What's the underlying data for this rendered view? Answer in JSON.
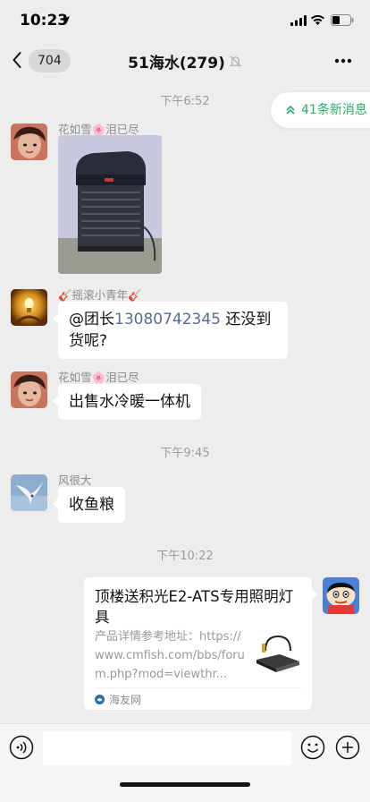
{
  "status_bar": {
    "time": "10:23"
  },
  "nav": {
    "unread_count": "704",
    "title": "51海水(279)"
  },
  "new_messages": {
    "label": "41条新消息"
  },
  "messages": {
    "time1": "下午6:52",
    "m1_sender": "花如雪🌸泪已尽",
    "m2_sender": "🎸摇滚小青年🎸",
    "m2_at": "@团长",
    "m2_phone": "13080742345",
    "m2_rest": " 还没到货呢?",
    "m3_sender": "花如雪🌸泪已尽",
    "m3_text": "出售水冷暖一体机",
    "time2": "下午9:45",
    "m4_sender": "风很大",
    "m4_text": "收鱼粮",
    "time3": "下午10:22",
    "card_title": "顶楼送积光E2-ATS专用照明灯具",
    "card_desc": "产品详情参考地址：https://www.cmfish.com/bbs/forum.php?mod=viewthr...",
    "card_source": "海友网"
  },
  "icons": {
    "back": "chevron-left-icon",
    "muted": "bell-slash-icon",
    "more": "ellipsis-icon",
    "voice": "voice-icon",
    "emoji": "emoji-icon",
    "plus": "plus-icon"
  },
  "colors": {
    "accent": "#2aae67",
    "link": "#576b95",
    "background": "#ededed"
  }
}
